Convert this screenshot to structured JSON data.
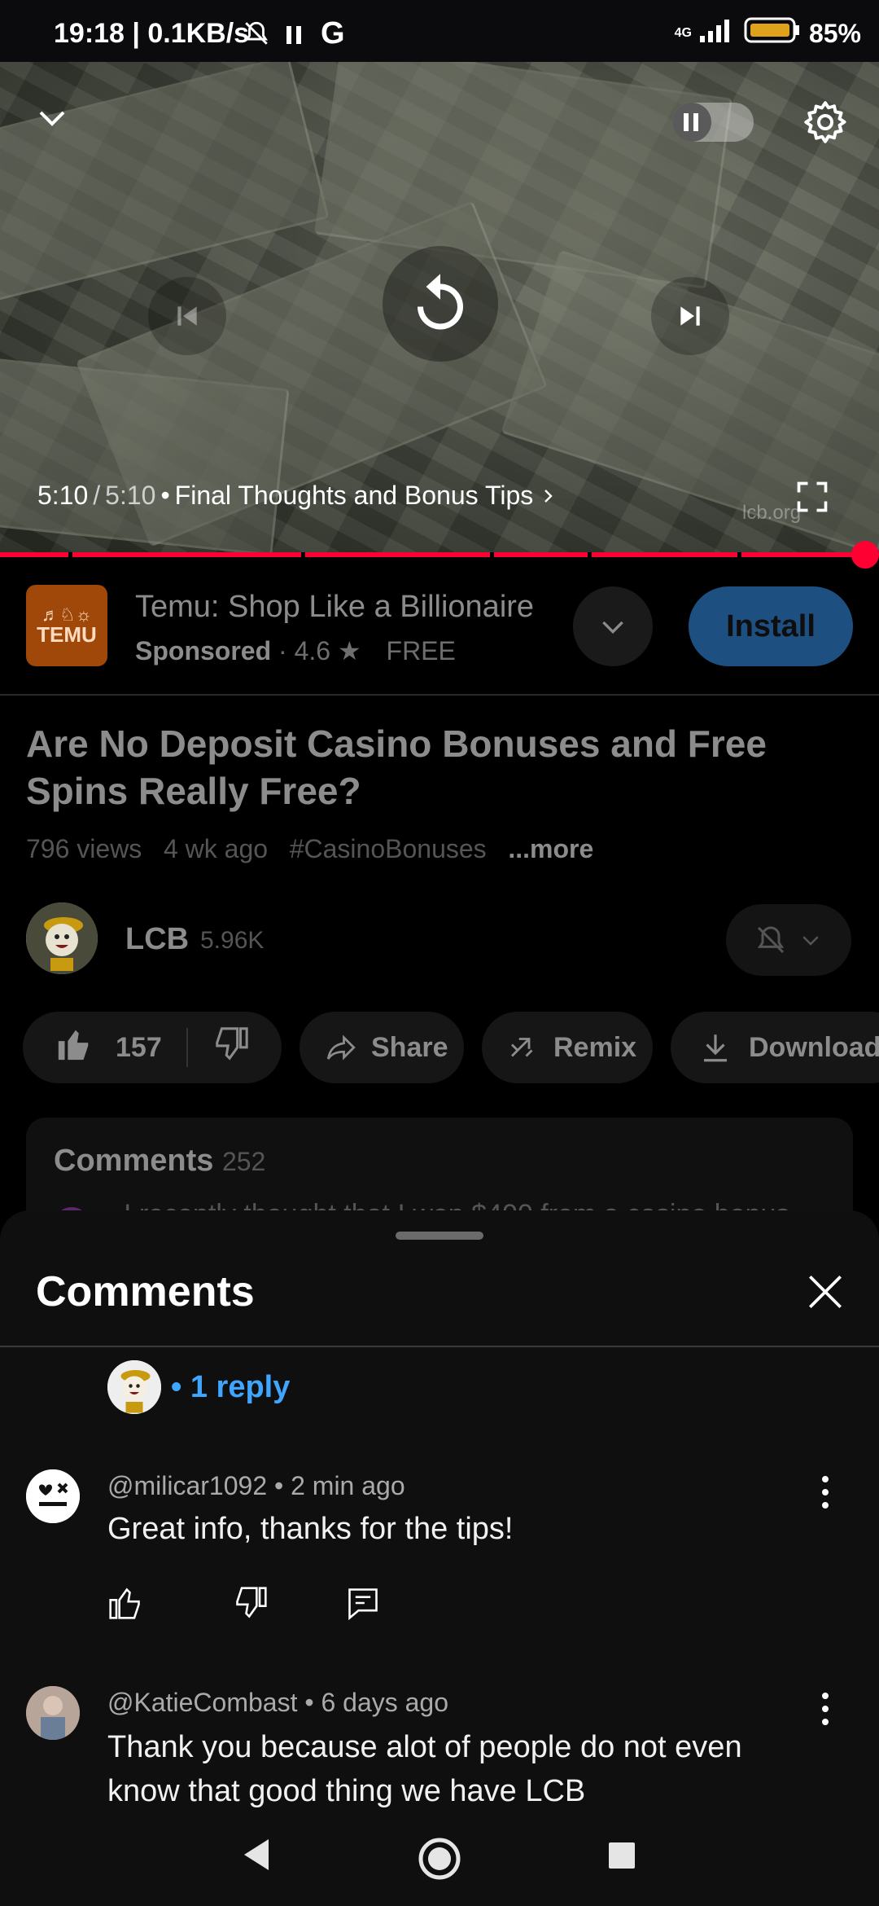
{
  "status_bar": {
    "time": "19:18 | 0.1KB/s",
    "network": "4G",
    "battery": "85%"
  },
  "player": {
    "time_current": "5:10",
    "time_total": "5:10",
    "chapter": "Final Thoughts and Bonus Tips",
    "watermark": "lcb.org",
    "progress": 1.0,
    "accent": "#ff0033"
  },
  "ad": {
    "app_name": "Temu: Shop Like a Billionaire",
    "sponsored": "Sponsored",
    "rating": "4.6",
    "price": "FREE",
    "install": "Install",
    "logo_text": "TEMU"
  },
  "video": {
    "title": "Are No Deposit Casino Bonuses and Free Spins Really Free?",
    "views": "796 views",
    "age": "4 wk ago",
    "hashtag": "#CasinoBonuses",
    "more": "...more"
  },
  "channel": {
    "name": "LCB",
    "subscribers": "5.96K"
  },
  "actions": {
    "likes": "157",
    "share": "Share",
    "remix": "Remix",
    "download": "Download"
  },
  "comments_teaser": {
    "label": "Comments",
    "count": "252",
    "preview": "I recently thought that I won $400 from a casino bonus"
  },
  "comments_sheet": {
    "title": "Comments",
    "reply_text": "• 1 reply",
    "comments": [
      {
        "handle": "@milicar1092",
        "age": "2 min ago",
        "text": "Great info, thanks for the tips!"
      },
      {
        "handle": "@KatieCombast",
        "age": "6 days ago",
        "text_line1": "Thank you because alot of people do not even",
        "text_line2": "know that good thing we have LCB"
      }
    ]
  }
}
